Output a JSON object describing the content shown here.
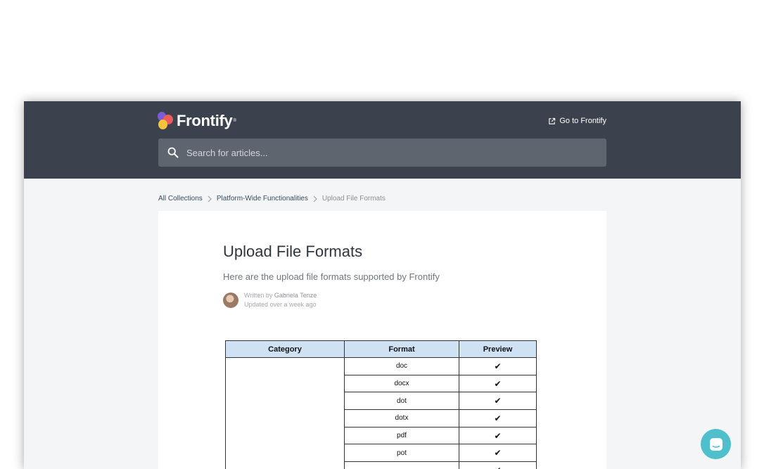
{
  "brand": {
    "name": "Frontify",
    "tm": "®"
  },
  "header": {
    "goto_label": "Go to Frontify"
  },
  "search": {
    "placeholder": "Search for articles..."
  },
  "breadcrumb": {
    "items": [
      "All Collections",
      "Platform-Wide Functionalities"
    ],
    "current": "Upload File Formats"
  },
  "article": {
    "title": "Upload File Formats",
    "subtitle": "Here are the upload file formats supported by Frontify",
    "written_by_prefix": "Written by",
    "author": "Gabriela Tenze",
    "updated": "Updated over a week ago"
  },
  "table": {
    "headers": [
      "Category",
      "Format",
      "Preview"
    ],
    "rows": [
      {
        "format": "doc",
        "preview": "✔"
      },
      {
        "format": "docx",
        "preview": "✔"
      },
      {
        "format": "dot",
        "preview": "✔"
      },
      {
        "format": "dotx",
        "preview": "✔"
      },
      {
        "format": "pdf",
        "preview": "✔"
      },
      {
        "format": "pot",
        "preview": "✔"
      },
      {
        "format": "",
        "preview": "✔"
      }
    ]
  },
  "colors": {
    "header_bg": "#3b424d",
    "page_bg": "#f3f5f7",
    "table_header_bg": "#cfe2f3",
    "chat_button": "#4fbfcc"
  },
  "icons": {
    "search": "search-icon",
    "external_link": "external-link-icon",
    "chevron": "chevron-right-icon",
    "chat": "chat-icon"
  }
}
